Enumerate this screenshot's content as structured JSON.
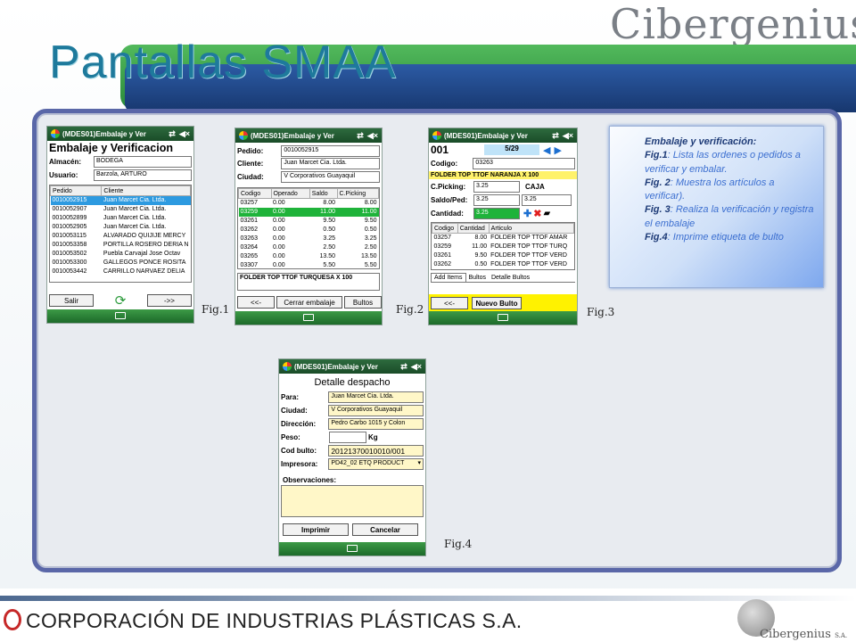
{
  "brand": "Cibergenius",
  "title": "Pantallas SMAA",
  "phone_title": "(MDES01)Embalaje y Ver",
  "fig1": {
    "heading": "Embalaje y Verificacion",
    "almacen_label": "Almacén:",
    "almacen_value": "BODEGA",
    "usuario_label": "Usuario:",
    "usuario_value": "Barzola, ARTURO",
    "col_pedido": "Pedido",
    "col_cliente": "Cliente",
    "rows": [
      [
        "0010052915",
        "Juan Marcet Cia. Ltda."
      ],
      [
        "0010052907",
        "Juan Marcet Cia. Ltda."
      ],
      [
        "0010052899",
        "Juan Marcet Cia. Ltda."
      ],
      [
        "0010052905",
        "Juan Marcet Cia. Ltda."
      ],
      [
        "0010053115",
        "ALVARADO QUIJIJE MERCY"
      ],
      [
        "0010053358",
        "PORTILLA ROSERO DERIA N"
      ],
      [
        "0010053502",
        "Puebla Carvajal Jose Octav"
      ],
      [
        "0010053300",
        "GALLEGOS PONCE ROSITA"
      ],
      [
        "0010053442",
        "CARRILLO NARVAEZ DELIA"
      ]
    ],
    "btn_salir": "Salir",
    "btn_next": "->>"
  },
  "fig2": {
    "pedido_label": "Pedido:",
    "pedido_value": "0010052915",
    "cliente_label": "Cliente:",
    "cliente_value": "Juan Marcet Cia. Ltda.",
    "ciudad_label": "Ciudad:",
    "ciudad_value": "V Corporativos Guayaquil",
    "cols": [
      "Codigo",
      "Operado",
      "Saldo",
      "C.Picking"
    ],
    "rows": [
      [
        "03257",
        "0.00",
        "8.00",
        "8.00"
      ],
      [
        "03259",
        "0.00",
        "11.00",
        "11.00"
      ],
      [
        "03261",
        "0.00",
        "9.50",
        "9.50"
      ],
      [
        "03262",
        "0.00",
        "0.50",
        "0.50"
      ],
      [
        "03263",
        "0.00",
        "3.25",
        "3.25"
      ],
      [
        "03264",
        "0.00",
        "2.50",
        "2.50"
      ],
      [
        "03265",
        "0.00",
        "13.50",
        "13.50"
      ],
      [
        "03307",
        "0.00",
        "5.50",
        "5.50"
      ]
    ],
    "article": "FOLDER TOP TTOF TURQUESA X 100",
    "btn_back": "<<-",
    "btn_cerrar": "Cerrar embalaje",
    "btn_bultos": "Bultos"
  },
  "fig3": {
    "num": "001",
    "counter": "5/29",
    "codigo_label": "Codigo:",
    "codigo_value": "03263",
    "article": "FOLDER TOP TTOF NARANJA X 100",
    "cpicking_label": "C.Picking:",
    "cpicking_value": "3.25",
    "caja": "CAJA",
    "saldo_label": "Saldo/Ped:",
    "saldo_value1": "3.25",
    "saldo_value2": "3.25",
    "cantidad_label": "Cantidad:",
    "cantidad_value": "3.25",
    "cols": [
      "Codigo",
      "Cantidad",
      "Articulo"
    ],
    "rows": [
      [
        "03257",
        "8.00",
        "FOLDER TOP TTOF AMAR"
      ],
      [
        "03259",
        "11.00",
        "FOLDER TOP TTOF TURQ"
      ],
      [
        "03261",
        "9.50",
        "FOLDER TOP TTOF VERD"
      ],
      [
        "03262",
        "0.50",
        "FOLDER TOP TTOF VERD"
      ]
    ],
    "tabs": [
      "Add Items",
      "Bultos",
      "Detalle Bultos"
    ],
    "btn_back": "<<-",
    "btn_nuevo": "Nuevo Bulto"
  },
  "fig4": {
    "heading": "Detalle despacho",
    "para_label": "Para:",
    "para_value": "Juan Marcet Cia. Ltda.",
    "ciudad_label": "Ciudad:",
    "ciudad_value": "V Corporativos Guayaquil",
    "direccion_label": "Dirección:",
    "direccion_value": "Pedro Carbo 1015 y Colon",
    "peso_label": "Peso:",
    "peso_unit": "Kg",
    "codbulto_label": "Cod bulto:",
    "codbulto_value": "20121370010010/001",
    "impresora_label": "Impresora:",
    "impresora_value": "PD42_02 ETQ PRODUCT",
    "obs_label": "Observaciones:",
    "btn_imprimir": "Imprimir",
    "btn_cancelar": "Cancelar"
  },
  "labels": {
    "fig1": "Fig.1",
    "fig2": "Fig.2",
    "fig3": "Fig.3",
    "fig4": "Fig.4"
  },
  "description": {
    "heading": "Embalaje y verificación:",
    "f1_key": "Fig.1",
    "f1_text": ": Lista las ordenes o pedidos a verificar y embalar.",
    "f2_key": "Fig. 2",
    "f2_text": ": Muestra los artículos a verificar).",
    "f3_key": "Fig. 3",
    "f3_text": ": Realiza la verificación y registra el embalaje",
    "f4_key": "Fig.4",
    "f4_text": ": Imprime etiqueta de bulto"
  },
  "footer": {
    "corp": "CORPORACIÓN DE INDUSTRIAS PLÁSTICAS S.A.",
    "brand": "Cibergenius",
    "suffix": "S.A."
  },
  "colors": {
    "accent_green": "#1fb33a",
    "selection_blue": "#2d9ae0",
    "title_blue": "#1e7a9c"
  }
}
